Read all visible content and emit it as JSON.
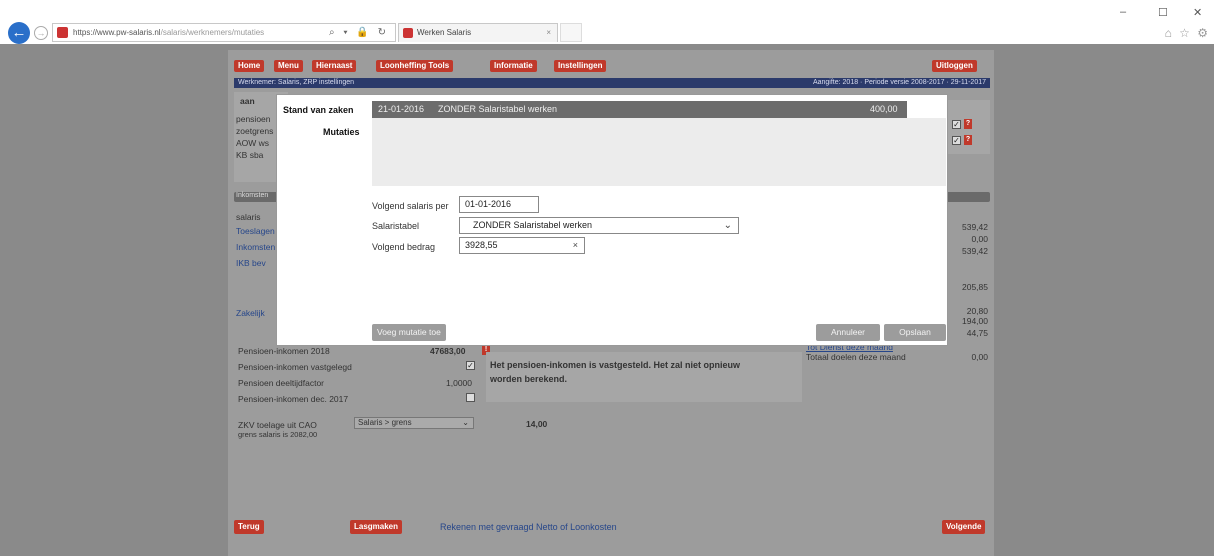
{
  "browser": {
    "url_host": "https://www.pw-salaris.nl",
    "url_path": "/salaris/werknemers/mutaties",
    "tab_title": "Werken Salaris",
    "tab_close": "×",
    "address_tools": "⌕ ▾ 🔒 ↻",
    "back_icon": "←",
    "forward_icon": "→",
    "win_minimize": "–",
    "win_maximize": "☐",
    "win_close": "✕",
    "right_icons": "⌂ ☆ ⚙"
  },
  "topnav": {
    "home": "Home",
    "menu": "Menu",
    "hiernaast": "Hiernaast",
    "loonheffing": "Loonheffing Tools",
    "informatie": "Informatie",
    "instellingen": "Instellingen",
    "uitloggen": "Uitloggen"
  },
  "titlebar": {
    "left": "Werknemer: Salaris, ZRP instellingen",
    "right": "Aangifte: 2018 · Periode versie 2008-2017 · 29-11-2017"
  },
  "background": {
    "row_label": "aan",
    "left_labels": [
      "pensioen",
      "zoetgrens",
      "AOW ws",
      "KB sba"
    ],
    "section_bar": "Inkomsten",
    "section_labels": [
      "salaris",
      "Toeslagen",
      "Inkomsten",
      "IKB bev"
    ],
    "zakelijk_label": "Zakelijk",
    "right_values": [
      "539,42",
      "0,00",
      "539,42",
      "205,85",
      "20,80",
      "194,00",
      "44,75"
    ],
    "pens_rows": [
      {
        "label": "Pensioen-inkomen 2018",
        "value": "47683,00"
      },
      {
        "label": "Pensioen-inkomen vastgelegd",
        "value": "✓"
      },
      {
        "label": "Pensioen deeltijdfactor",
        "value": "1,0000"
      },
      {
        "label": "Pensioen-inkomen dec. 2017",
        "value": ""
      }
    ],
    "notice_line1": "Het pensioen-inkomen is vastgesteld. Het zal niet opnieuw",
    "notice_line2": "worden berekend.",
    "totals_head": "Tot Dienst deze maand",
    "totals_label": "Totaal doelen deze maand",
    "totals_value": "0,00",
    "zkv_label": "ZKV toelage uit CAO",
    "zkv_sub": "grens salaris is 2082,00",
    "zkv_select": "Salaris > grens",
    "zkv_value": "14,00"
  },
  "footer": {
    "terug": "Terug",
    "lasgmaken": "Lasgmaken",
    "link": "Rekenen met gevraagd Netto of Loonkosten",
    "volgende": "Volgende"
  },
  "modal": {
    "stand_label": "Stand van zaken",
    "mutaties_label": "Mutaties",
    "status_date": "21-01-2016",
    "status_text": "ZONDER Salaristabel werken",
    "status_amount": "400,00",
    "volgend_salaris_per_label": "Volgend salaris per",
    "volgend_salaris_per_value": "01-01-2016",
    "salaristabel_label": "Salaristabel",
    "salaristabel_value": "ZONDER Salaristabel werken",
    "volgend_bedrag_label": "Volgend bedrag",
    "volgend_bedrag_value": "3928,55",
    "clear_icon": "×",
    "chevron_icon": "⌄",
    "add_button": "Voeg mutatie toe",
    "cancel_button": "Annuleer",
    "save_button": "Opslaan"
  },
  "colors": {
    "accent_red": "#c0392b",
    "overlay_grey": "#8a8a8a",
    "title_blue": "#2b3a6b"
  }
}
